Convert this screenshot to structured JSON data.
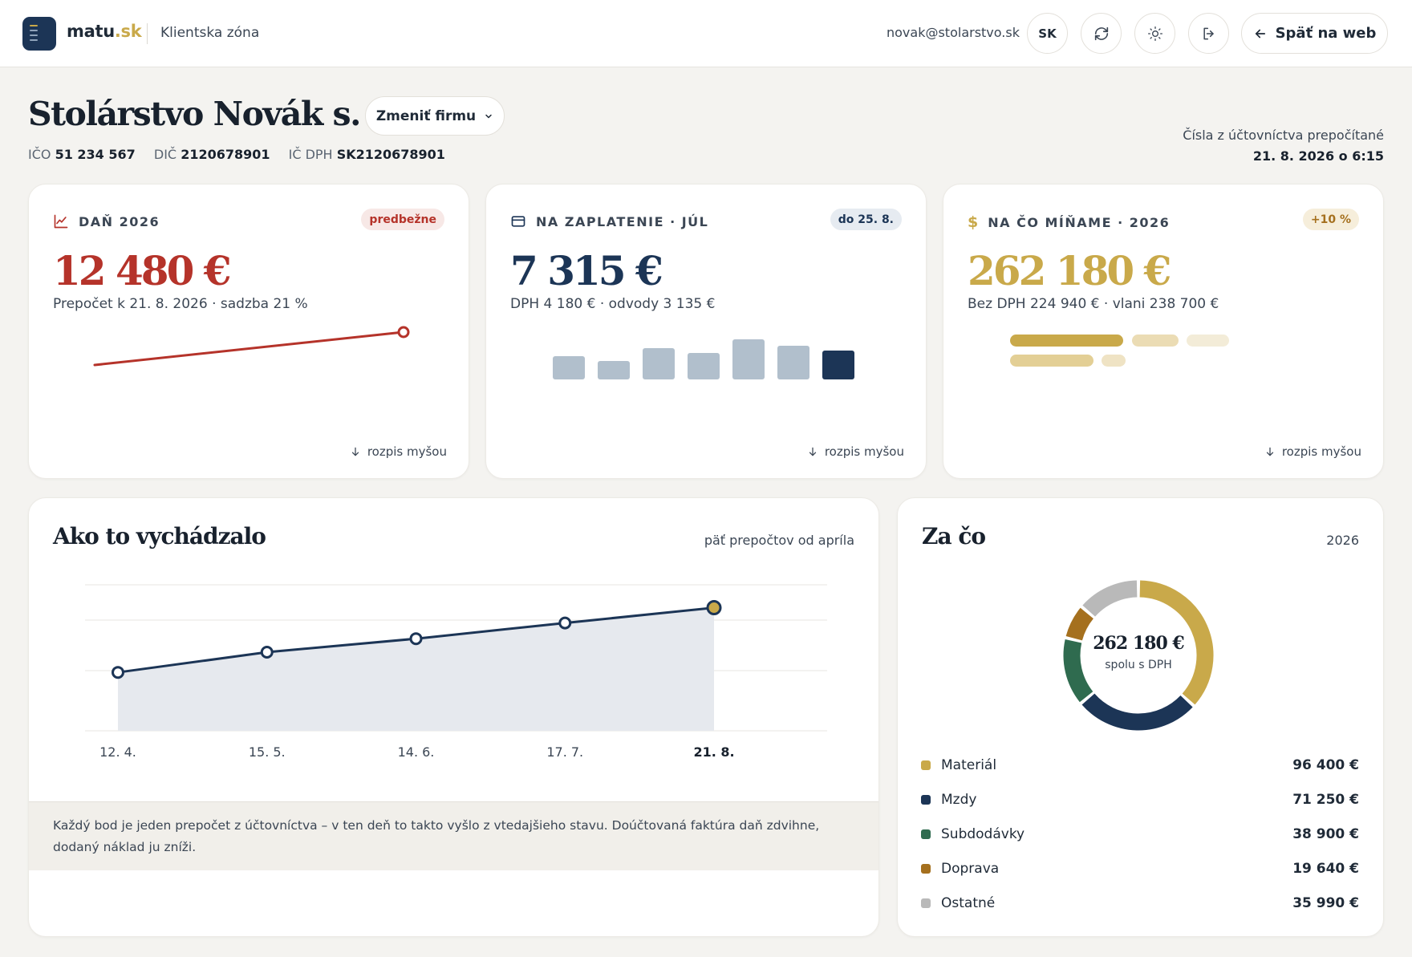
{
  "header": {
    "brand_name": "matu",
    "brand_tld": ".sk",
    "zone": "Klientska zóna",
    "email": "novak@stolarstvo.sk",
    "lang": "SK",
    "back_label": "Späť na web"
  },
  "company": {
    "name": "Stolárstvo Novák s. r. o.",
    "change_label": "Zmeniť firmu",
    "ico_label": "IČO",
    "ico": "51 234 567",
    "dic_label": "DIČ",
    "dic": "2120678901",
    "icdph_label": "IČ DPH",
    "icdph": "SK2120678901",
    "recalc_note": "Čísla z účtovníctva prepočítané",
    "recalc_time": "21. 8. 2026 o 6:15"
  },
  "cards": {
    "tax": {
      "title": "DAŇ 2026",
      "badge": "predbežne",
      "amount": "12 480 €",
      "sub": "Prepočet k 21. 8. 2026 · sadzba 21 %",
      "hover": "rozpis myšou",
      "color": "#b5332a"
    },
    "pay": {
      "title": "NA ZAPLATENIE · JÚL",
      "badge": "do 25. 8.",
      "amount": "7 315 €",
      "sub": "DPH 4 180 € · odvody 3 135 €",
      "hover": "rozpis myšou",
      "color": "#1c3556"
    },
    "spend": {
      "title": "NA ČO MÍŇAME · 2026",
      "badge": "+10 %",
      "amount": "262 180 €",
      "sub": "Bez DPH 224 940 € · vlani 238 700 €",
      "hover": "rozpis myšou",
      "color": "#c9a94a"
    }
  },
  "history": {
    "title": "Ako to vychádzalo",
    "subtitle": "päť prepočtov od apríla",
    "note": "Každý bod je jeden prepočet z účtovníctva – v ten deň to takto vyšlo z vtedajšieho stavu. Doúčtovaná faktúra daň zdvihne, dodaný náklad ju zníži."
  },
  "breakdown": {
    "title": "Za čo",
    "year": "2026",
    "center_value": "262 180 €",
    "center_label": "spolu s DPH",
    "items": [
      {
        "label": "Materiál",
        "value": "96 400 €",
        "color": "#c9a94a"
      },
      {
        "label": "Mzdy",
        "value": "71 250 €",
        "color": "#1c3556"
      },
      {
        "label": "Subdodávky",
        "value": "38 900 €",
        "color": "#2f6b4f"
      },
      {
        "label": "Doprava",
        "value": "19 640 €",
        "color": "#a5701e"
      },
      {
        "label": "Ostatné",
        "value": "35 990 €",
        "color": "#b9b9b9"
      }
    ]
  },
  "chart_data": [
    {
      "type": "line",
      "x": [
        "12. 4.",
        "15. 5.",
        "14. 6.",
        "17. 7.",
        "21. 8."
      ],
      "values": [
        9600,
        10500,
        11100,
        11800,
        12480
      ],
      "ylim": [
        7000,
        13500
      ],
      "grid": true,
      "colors": {
        "line": "#1c3556",
        "area": "#e6e9ee",
        "last_point": "#c9a94a"
      }
    },
    {
      "type": "bar",
      "values": [
        29,
        23,
        39,
        33,
        50,
        42,
        36
      ],
      "ylim": [
        0,
        60
      ],
      "colors": {
        "bar": "#b1bfcc",
        "highlight": "#1c3556"
      }
    },
    {
      "type": "pie",
      "categories": [
        "Materiál",
        "Mzdy",
        "Subdodávky",
        "Doprava",
        "Ostatné"
      ],
      "values": [
        96400,
        71250,
        38900,
        19640,
        35990
      ]
    }
  ]
}
